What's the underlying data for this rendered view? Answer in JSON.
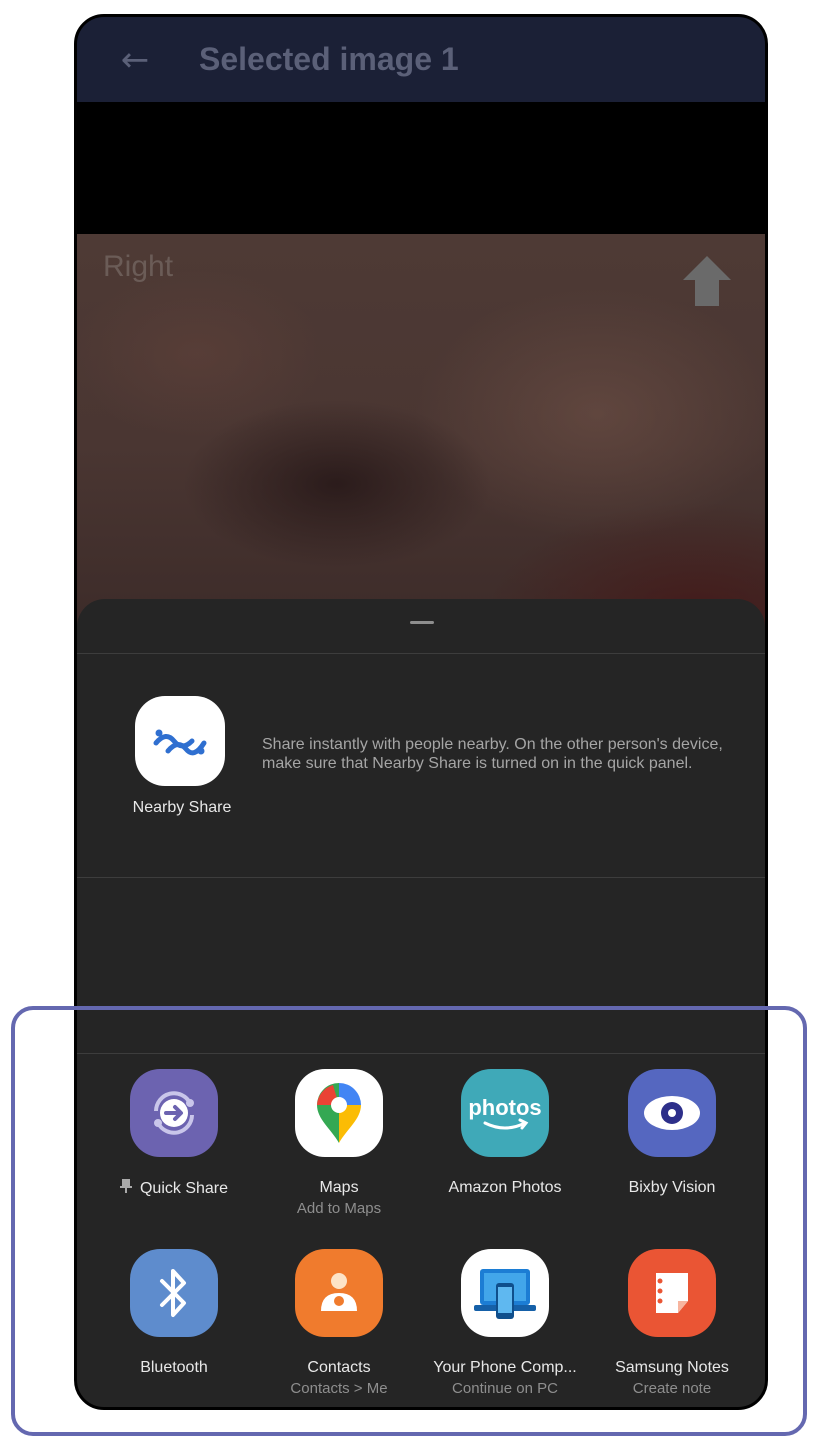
{
  "app_bar": {
    "title": "Selected image 1"
  },
  "photo": {
    "label": "Right"
  },
  "nearby_share": {
    "label": "Nearby Share",
    "description": "Share instantly with people nearby. On the other person's device, make sure that Nearby Share is turned on in the quick panel."
  },
  "apps": [
    {
      "name": "Quick Share",
      "sub": "",
      "icon": "quick-share-icon",
      "color": "#6c63b0"
    },
    {
      "name": "Maps",
      "sub": "Add to Maps",
      "icon": "maps-icon",
      "color": "#ffffff"
    },
    {
      "name": "Amazon Photos",
      "sub": "",
      "icon": "amazon-photos-icon",
      "color": "#3fa9b8"
    },
    {
      "name": "Bixby Vision",
      "sub": "",
      "icon": "bixby-vision-icon",
      "color": "#5567c0"
    },
    {
      "name": "Bluetooth",
      "sub": "",
      "icon": "bluetooth-icon",
      "color": "#5e8ccd"
    },
    {
      "name": "Contacts",
      "sub": "Contacts > Me",
      "icon": "contacts-icon",
      "color": "#f07b2d"
    },
    {
      "name": "Your Phone Comp...",
      "sub": "Continue on PC",
      "icon": "your-phone-icon",
      "color": "#ffffff"
    },
    {
      "name": "Samsung Notes",
      "sub": "Create note",
      "icon": "samsung-notes-icon",
      "color": "#ea5534"
    }
  ],
  "colors": {
    "highlight": "#6468b0",
    "sheet": "#252525",
    "appbar": "#1b2036"
  }
}
